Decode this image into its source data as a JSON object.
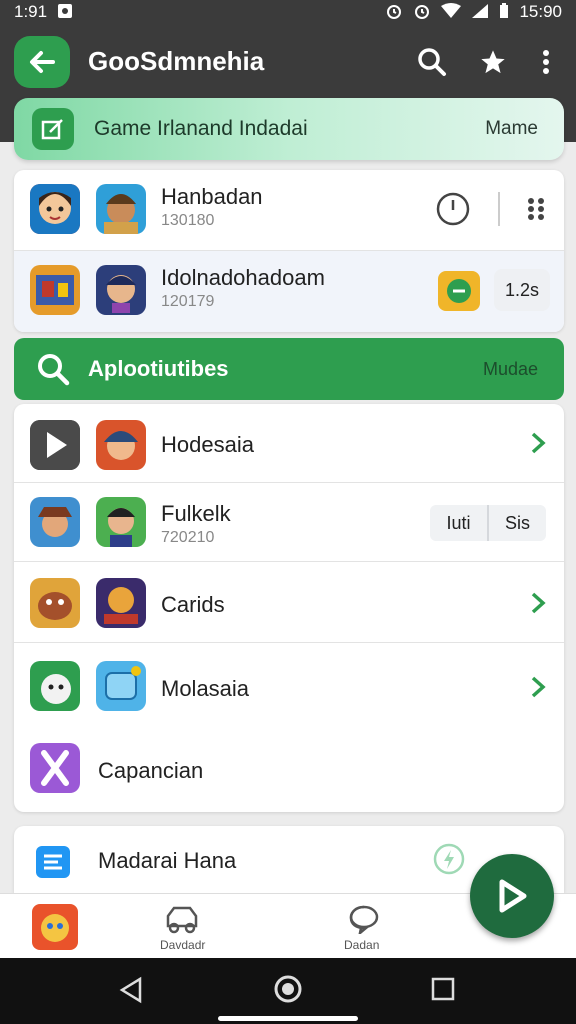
{
  "status": {
    "time_left": "1:91",
    "time_right": "15:90"
  },
  "app_bar": {
    "title": "GooSdmnehia"
  },
  "banner": {
    "label": "Game Irlanand Indadai",
    "right_label": "Mame"
  },
  "top_list": [
    {
      "title": "Hanbadan",
      "subtitle": "130180"
    },
    {
      "title": "Idolnadohadoam",
      "subtitle": "120179",
      "pill": "1.2s"
    }
  ],
  "section": {
    "title": "Aplootiutibes",
    "right_label": "Mudae"
  },
  "main_list": [
    {
      "title": "Hodesaia"
    },
    {
      "title": "Fulkelk",
      "subtitle": "720210",
      "pill_left": "Iuti",
      "pill_right": "Sis"
    },
    {
      "title": "Carids"
    },
    {
      "title": "Molasaia"
    },
    {
      "title": "Capancian"
    }
  ],
  "last_card": {
    "title": "Madarai Hana"
  },
  "bottom_nav": [
    {
      "label": "Davdadr"
    },
    {
      "label": "Dadan"
    }
  ],
  "colors": {
    "accent": "#2e9e4f",
    "bar": "#3b3b3b",
    "fab": "#1f6b3e"
  }
}
